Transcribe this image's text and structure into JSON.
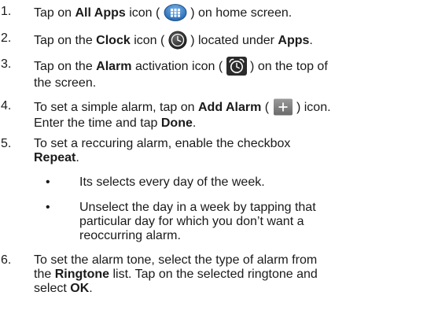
{
  "steps": [
    {
      "num": "1.",
      "t1": "Tap on ",
      "b1": "All Apps",
      "t2": " icon ( ",
      "icon": "all-apps-grid-icon",
      "t3": " ) on home screen."
    },
    {
      "num": "2.",
      "t1": "Tap on the ",
      "b1": "Clock",
      "t2": " icon ( ",
      "icon": "clock-app-icon",
      "t3": " ) located under ",
      "b2": "Apps",
      "t4": "."
    },
    {
      "num": "3.",
      "t1": "Tap on the ",
      "b1": "Alarm",
      "t2": " activation icon ( ",
      "icon": "alarm-clock-icon",
      "t3": " ) on the top of",
      "line2": "the screen."
    },
    {
      "num": "4.",
      "t1": "To set a simple alarm, tap on ",
      "b1": "Add Alarm",
      "t2": " ( ",
      "icon": "add-plus-icon",
      "t3": " ) icon.",
      "l2a": "Enter the time and tap ",
      "l2b": "Done",
      "l2c": "."
    },
    {
      "num": "5.",
      "t1": "To set a reccuring alarm, enable the checkbox",
      "b1": "Repeat",
      "t2": "."
    },
    {
      "num": "6.",
      "l1": "To set the alarm tone, select the type of alarm from",
      "l2a": "the ",
      "l2b": "Ringtone",
      "l2c": " list. Tap on the selected ringtone and",
      "l3a": "select ",
      "l3b": "OK",
      "l3c": "."
    }
  ],
  "bullets": [
    {
      "mark": "•",
      "lines": [
        "Its selects every day of the week."
      ]
    },
    {
      "mark": "•",
      "lines": [
        "Unselect the day in a week by tapping that",
        "particular day for which you don’t want a",
        "reoccurring alarm."
      ]
    }
  ]
}
